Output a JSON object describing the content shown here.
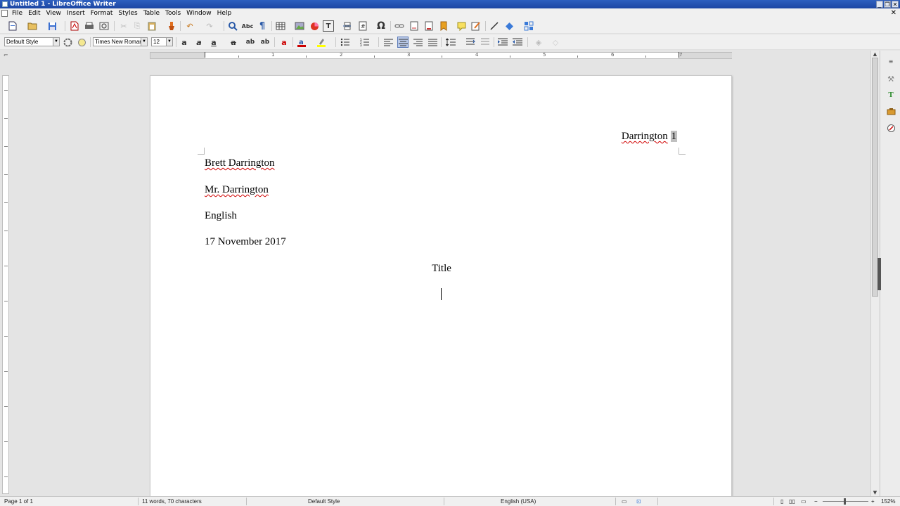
{
  "window": {
    "title": "Untitled 1 - LibreOffice Writer",
    "controls": [
      "_",
      "❐",
      "✕"
    ]
  },
  "menu": {
    "items": [
      "File",
      "Edit",
      "View",
      "Insert",
      "Format",
      "Styles",
      "Table",
      "Tools",
      "Window",
      "Help"
    ],
    "close": "✕"
  },
  "formatting": {
    "paragraph_style": "Default Style",
    "font_name": "Times New Roman",
    "font_size": "12",
    "active_alignment": "center"
  },
  "ruler": {
    "labels": [
      "1",
      "2",
      "3",
      "4",
      "5",
      "6",
      "7"
    ]
  },
  "document": {
    "header_text": "Darrington",
    "header_page_number": "1",
    "lines": [
      "Brett Darrington",
      "Mr. Darrington",
      "English",
      "17 November 2017"
    ],
    "title": "Title"
  },
  "status": {
    "page": "Page 1 of 1",
    "words": "11 words, 70 characters",
    "page_style": "Default Style",
    "language": "English (USA)",
    "zoom": "152%"
  },
  "colors": {
    "titlebar": "#2d5fbf",
    "spellcheck": "#d00000",
    "active_button": "#b9c9e8"
  }
}
